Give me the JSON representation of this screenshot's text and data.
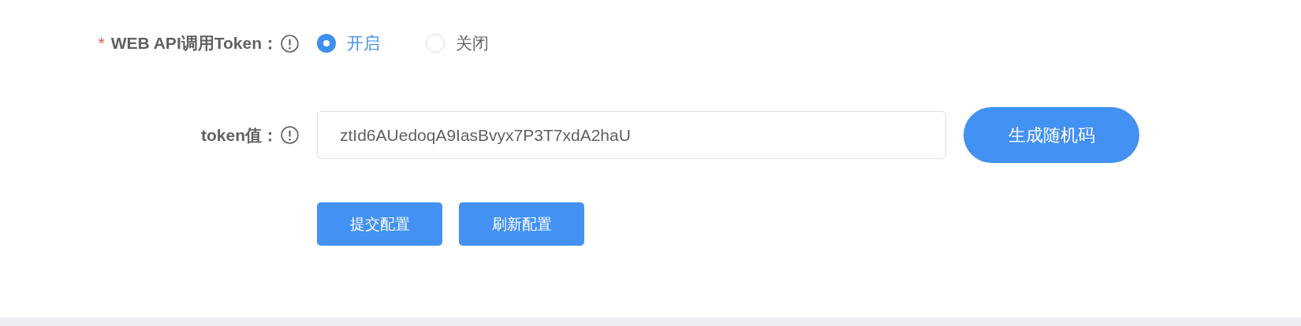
{
  "form": {
    "fields": [
      {
        "kind": "radio",
        "label": "WEB API调用Token：",
        "required_mark": "*",
        "options": [
          {
            "label": "开启",
            "selected": true
          },
          {
            "label": "关闭",
            "selected": false
          }
        ]
      },
      {
        "kind": "input",
        "label": "token值：",
        "value": "ztId6AUedoqA9IasBvyx7P3T7xdA2haU",
        "action": "生成随机码"
      }
    ],
    "buttons": [
      "提交配置",
      "刷新配置"
    ]
  }
}
